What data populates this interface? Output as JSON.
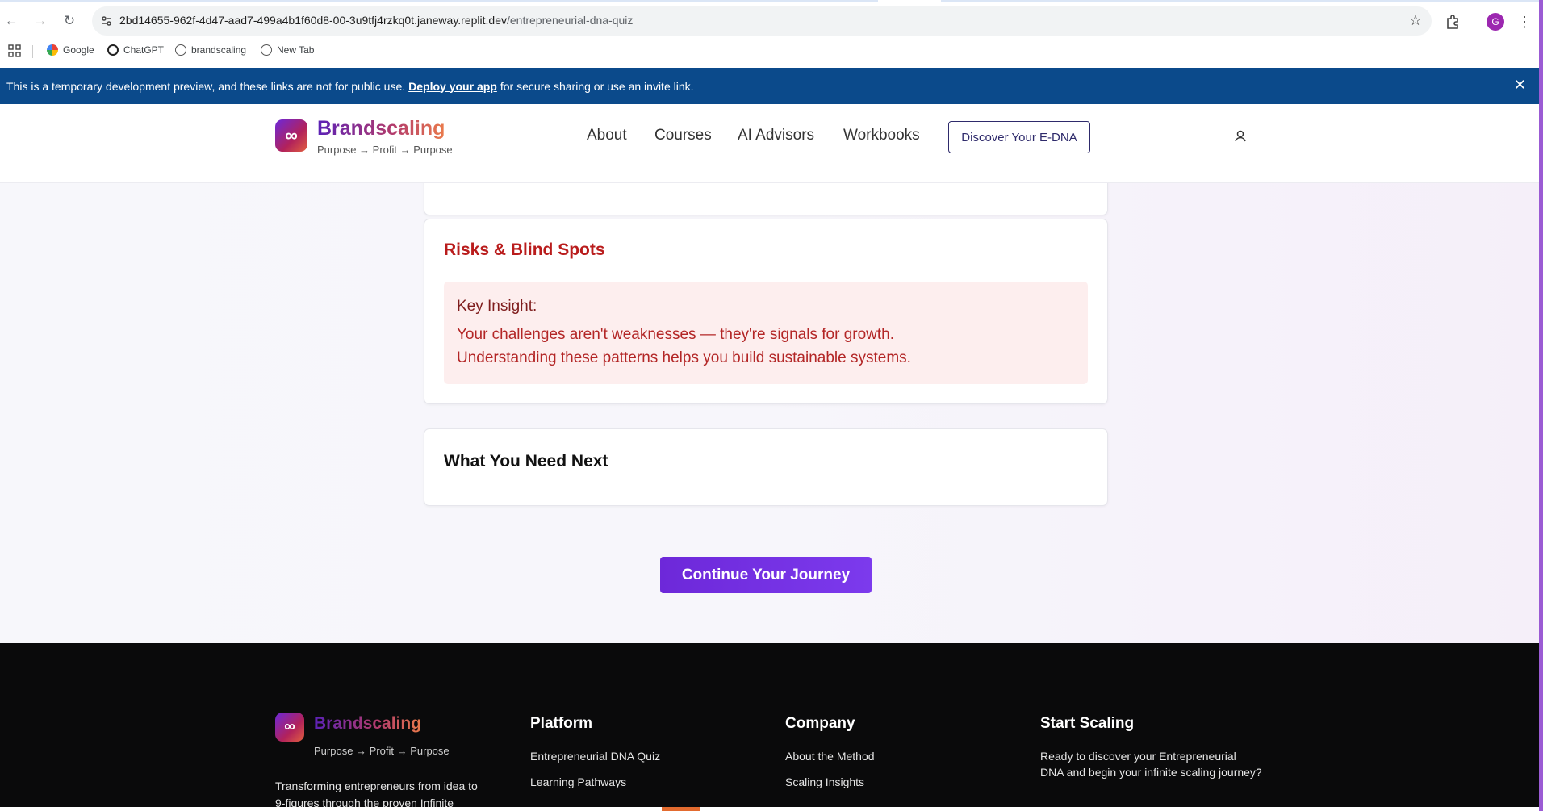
{
  "browser": {
    "url_main": "2bd14655-962f-4d47-aad7-499a4b1f60d8-00-3u9tfj4rzkq0t.janeway.replit.dev",
    "url_path": "/entrepreneurial-dna-quiz",
    "profile_initial": "G",
    "bookmarks": [
      {
        "label": "Google",
        "icon": "google-icon"
      },
      {
        "label": "ChatGPT",
        "icon": "chatgpt-icon"
      },
      {
        "label": "brandscaling",
        "icon": "globe-icon"
      },
      {
        "label": "New Tab",
        "icon": "globe-icon"
      }
    ]
  },
  "banner": {
    "text_before": "This is a temporary development preview, and these links are not for public use.",
    "link": "Deploy your app",
    "text_after": "for secure sharing or use an invite link.",
    "close": "✕"
  },
  "header": {
    "brand": "Brandscaling",
    "tagline": "Purpose → Profit → Purpose",
    "nav": [
      "About",
      "Courses",
      "AI Advisors",
      "Workbooks"
    ],
    "cta": "Discover Your E-DNA"
  },
  "main": {
    "risks_title": "Risks & Blind Spots",
    "insight_label": "Key Insight:",
    "insight_line1": "Your challenges aren't weaknesses — they're signals for growth.",
    "insight_line2": "Understanding these patterns helps you build sustainable systems.",
    "next_title": "What You Need Next",
    "continue_button": "Continue Your Journey"
  },
  "footer": {
    "brand": "Brandscaling",
    "tagline": "Purpose → Profit → Purpose",
    "description": "Transforming entrepreneurs from idea to 9-figures through the proven Infinite",
    "platform_title": "Platform",
    "platform_links": [
      "Entrepreneurial DNA Quiz",
      "Learning Pathways"
    ],
    "company_title": "Company",
    "company_links": [
      "About the Method",
      "Scaling Insights"
    ],
    "start_title": "Start Scaling",
    "start_text": "Ready to discover your Entrepreneurial DNA and begin your infinite scaling journey?"
  },
  "colors": {
    "banner": "#0b4a8b",
    "accent_purple": "#6d28d9",
    "risk_red": "#b91c1c",
    "footer_bg": "#0a0a0b"
  }
}
